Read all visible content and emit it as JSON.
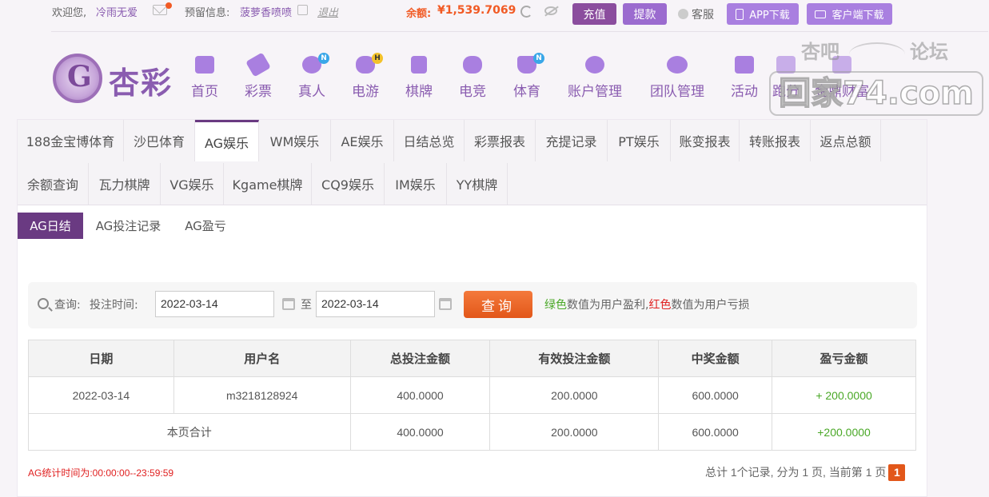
{
  "topbar": {
    "welcome": "欢迎您,",
    "username": "冷雨无爱",
    "preset_label": "预留信息:",
    "preset_value": "菠萝香喷喷",
    "logout": "退出",
    "balance_label": "余额:",
    "balance_value": "¥1,539.7069",
    "recharge": "充值",
    "withdraw": "提款",
    "service": "客服",
    "app_download": "APP下载",
    "client_download": "客户端下载"
  },
  "brand": {
    "name": "杏彩"
  },
  "nav": [
    {
      "label": "首页",
      "icon": "home-icon",
      "badge": ""
    },
    {
      "label": "彩票",
      "icon": "ticket-icon",
      "badge": ""
    },
    {
      "label": "真人",
      "icon": "live-dealer-icon",
      "badge": "N"
    },
    {
      "label": "电游",
      "icon": "gamepad-icon",
      "badge": "H"
    },
    {
      "label": "棋牌",
      "icon": "cards-icon",
      "badge": ""
    },
    {
      "label": "电竞",
      "icon": "esports-icon",
      "badge": ""
    },
    {
      "label": "体育",
      "icon": "trophy-icon",
      "badge": "N"
    },
    {
      "label": "账户管理",
      "icon": "account-icon",
      "badge": ""
    },
    {
      "label": "团队管理",
      "icon": "team-icon",
      "badge": ""
    },
    {
      "label": "活动",
      "icon": "gift-icon",
      "badge": ""
    },
    {
      "label": "跑分",
      "icon": "run-icon",
      "badge": ""
    },
    {
      "label": "金鼎财富",
      "icon": "wealth-icon",
      "badge": ""
    }
  ],
  "watermark": {
    "line1_left": "杏吧",
    "line1_right": "论坛",
    "line2": "回家74.com"
  },
  "tabs_row1": [
    "188金宝博体育",
    "沙巴体育",
    "AG娱乐",
    "WM娱乐",
    "AE娱乐",
    "日结总览",
    "彩票报表",
    "充提记录",
    "PT娱乐",
    "账变报表",
    "转账报表",
    "返点总额"
  ],
  "tabs_row2": [
    "余额查询",
    "瓦力棋牌",
    "VG娱乐",
    "Kgame棋牌",
    "CQ9娱乐",
    "IM娱乐",
    "YY棋牌"
  ],
  "subtabs": [
    "AG日结",
    "AG投注记录",
    "AG盈亏"
  ],
  "search": {
    "query_label": "查询:",
    "time_label": "投注时间:",
    "date_from": "2022-03-14",
    "to_label": "至",
    "date_to": "2022-03-14",
    "button": "查询",
    "hint_green": "绿色",
    "hint_mid": "数值为用户盈利,",
    "hint_red": "红色",
    "hint_end": "数值为用户亏损"
  },
  "table": {
    "headers": [
      "日期",
      "用户名",
      "总投注金额",
      "有效投注金额",
      "中奖金额",
      "盈亏金额"
    ],
    "rows": [
      [
        "2022-03-14",
        "m3218128924",
        "400.0000",
        "200.0000",
        "600.0000",
        "+ 200.0000"
      ]
    ],
    "total_label": "本页合计",
    "total": [
      "400.0000",
      "200.0000",
      "600.0000",
      "+200.0000"
    ]
  },
  "footer": {
    "stat_time": "AG统计时间为:00:00:00--23:59:59",
    "pager_text": "总计 1个记录, 分为 1 页, 当前第 1 页",
    "current_page": "1"
  },
  "colors": {
    "brand": "#8a5cb0",
    "accent": "#f15a24",
    "active_tab": "#6a3a82",
    "profit": "#4aa827",
    "loss": "#e02020"
  }
}
